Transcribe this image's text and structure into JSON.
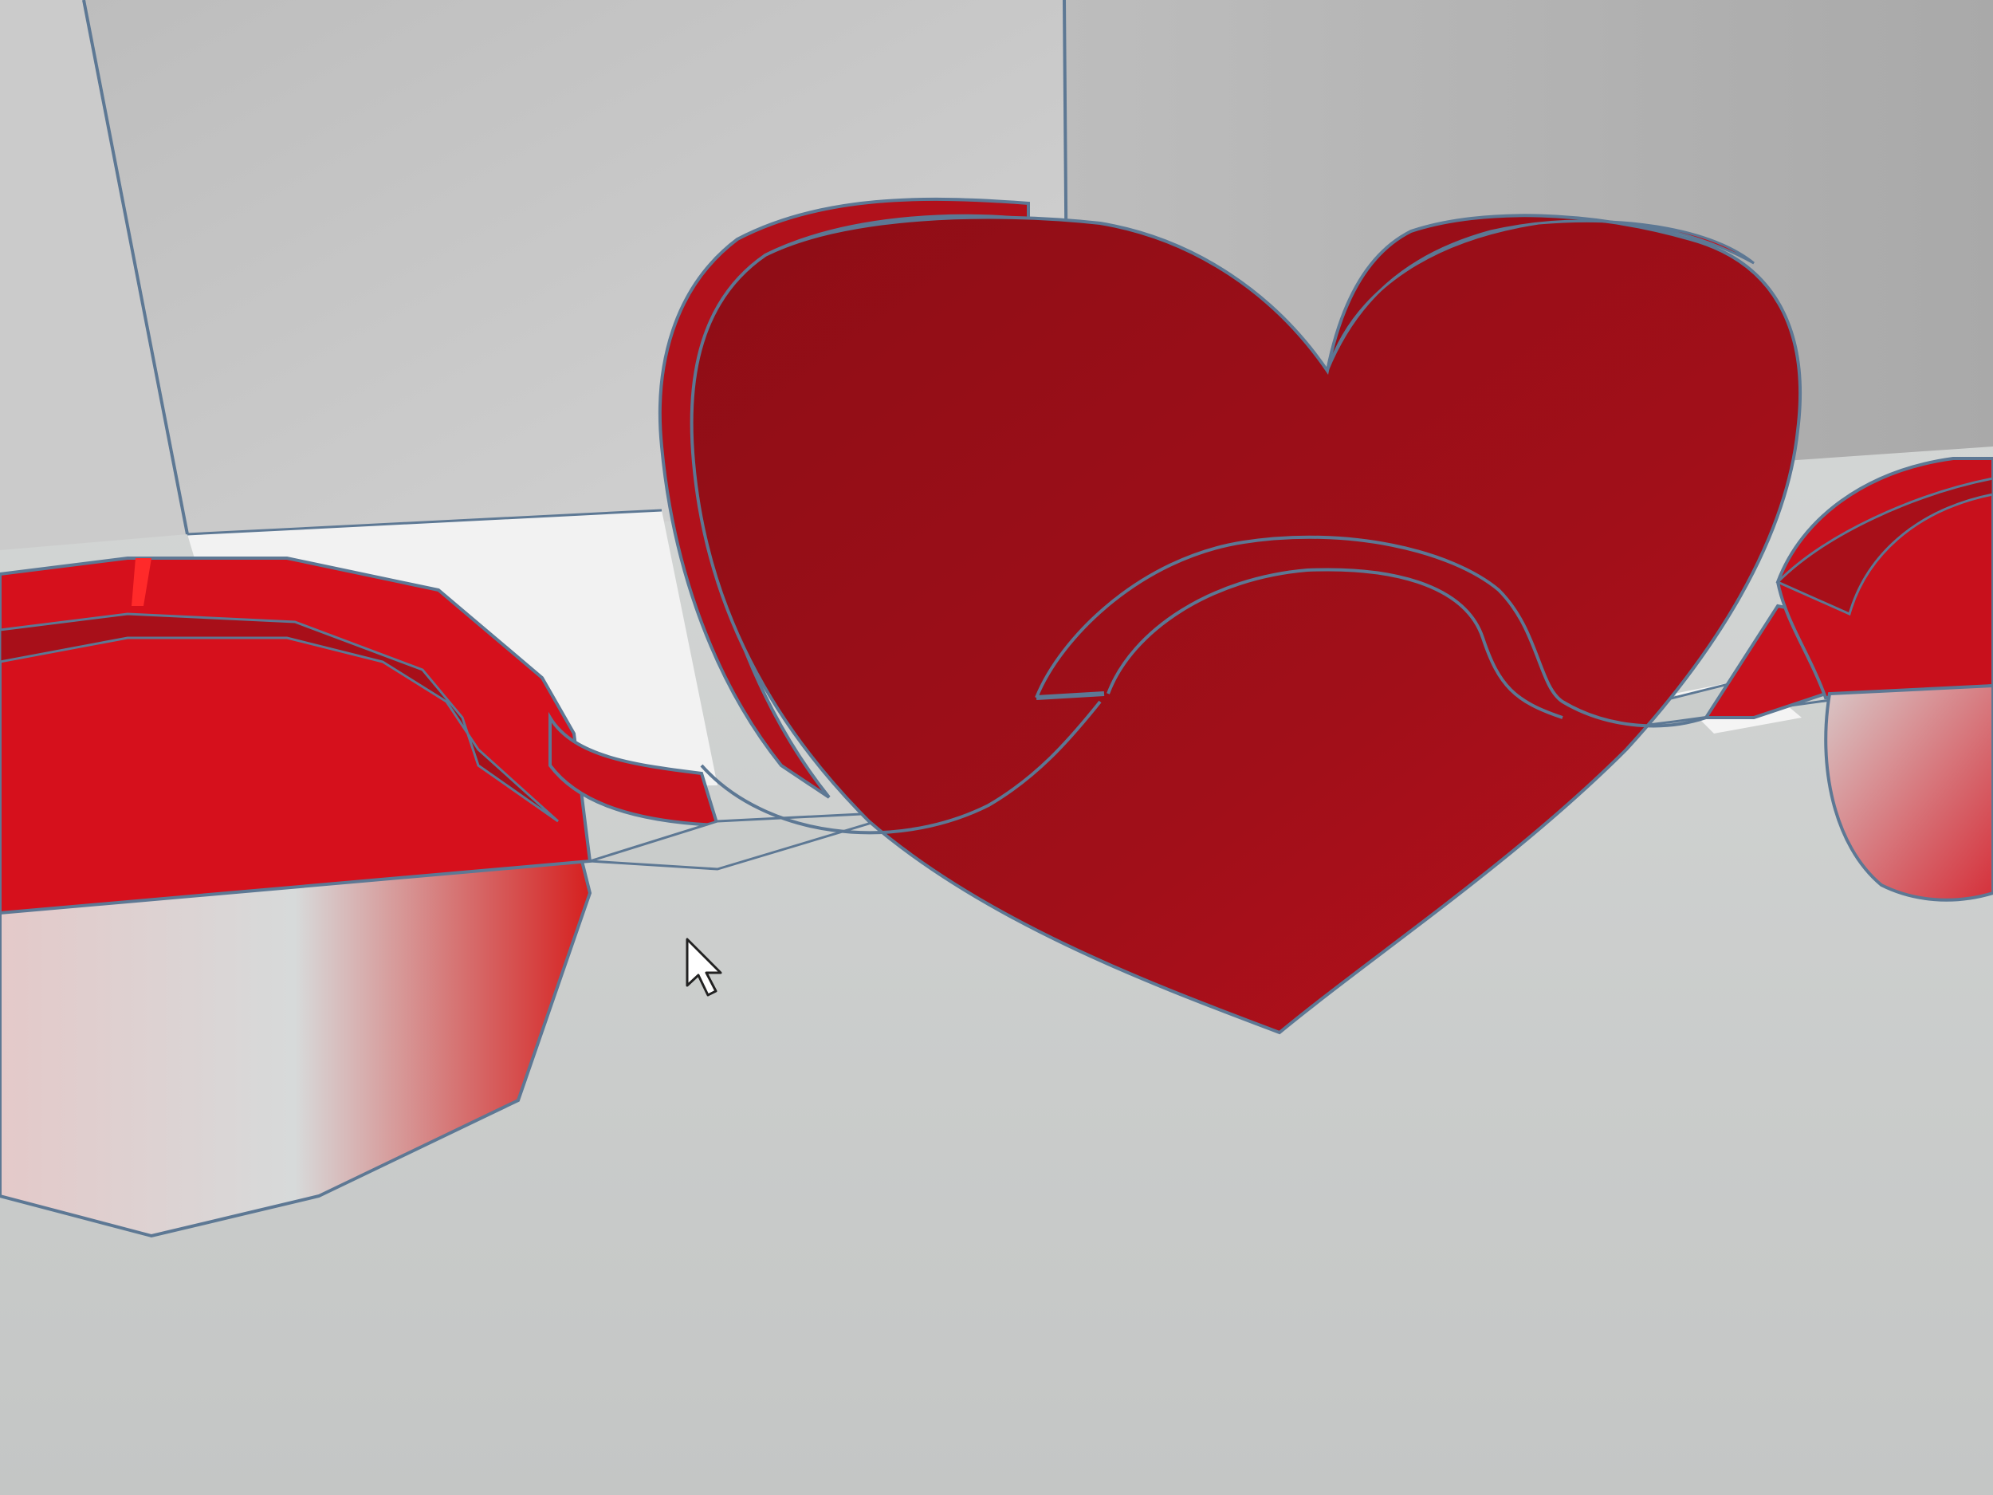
{
  "viewport": {
    "kind": "3d-modeling-viewport",
    "colors": {
      "model_red": "#c8101c",
      "model_red_dark": "#8e0d16",
      "model_red_mid": "#a80f19",
      "wall_back": "#c6c6c6",
      "wall_right": "#b4b4b4",
      "floor": "#d3d6d5",
      "floor_white": "#f2f2f2",
      "outline": "#5d7894"
    },
    "objects": [
      {
        "name": "heart-model",
        "shape": "heart",
        "selected": true
      },
      {
        "name": "left-ring-model",
        "shape": "ring",
        "selected": true
      },
      {
        "name": "right-ring-model",
        "shape": "ring",
        "selected": true
      },
      {
        "name": "connector-model",
        "shape": "curved-band",
        "selected": true
      }
    ],
    "cursor": {
      "icon": "arrow-pointer-icon"
    }
  }
}
